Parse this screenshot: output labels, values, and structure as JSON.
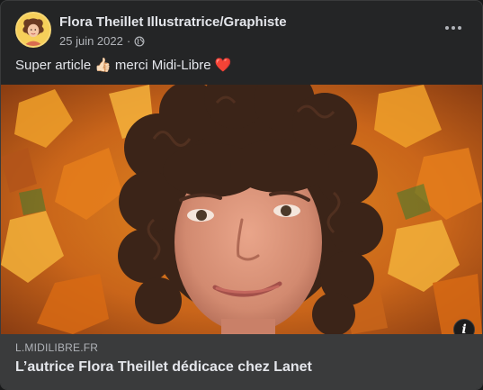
{
  "post": {
    "author": "Flora Theillet Illustratrice/Graphiste",
    "date": "25 juin 2022",
    "separator": "·",
    "privacy_icon": "globe-icon",
    "more_icon": "more-options-icon",
    "caption_before": "Super article",
    "caption_emoji_thumb": "👍🏻",
    "caption_middle": "merci Midi-Libre",
    "caption_emoji_heart": "❤️"
  },
  "link": {
    "domain": "L.MIDILIBRE.FR",
    "title": "L’autrice Flora Theillet dédicace chez Lanet",
    "info_icon_glyph": "i"
  },
  "colors": {
    "card_bg": "#242526",
    "footer_bg": "#3a3b3c",
    "text_primary": "#e4e6eb",
    "text_secondary": "#b0b3b8",
    "heart": "#f02849",
    "avatar_bg": "#f2c94c"
  }
}
